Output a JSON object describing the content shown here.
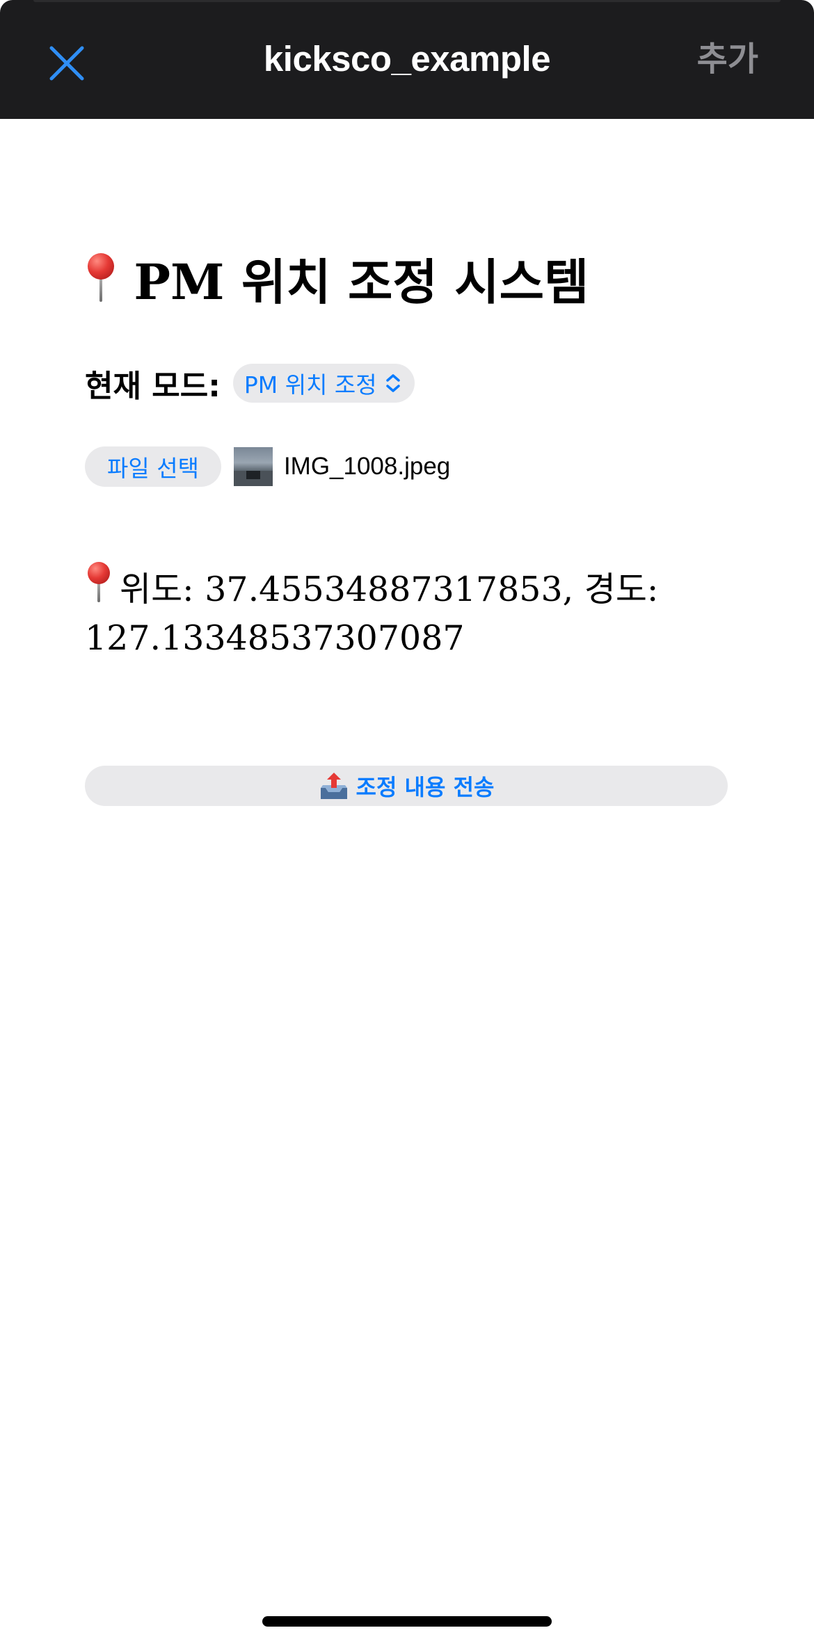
{
  "navbar": {
    "title": "kicksco_example",
    "add_label": "추가",
    "close_icon": "close-icon",
    "close_color": "#2f8ef5"
  },
  "page": {
    "heading": "PM 위치 조정 시스템",
    "heading_icon": "pushpin-icon",
    "mode_label": "현재 모드:",
    "mode_selected": "PM 위치 조정",
    "file_button_label": "파일 선택",
    "file_name": "IMG_1008.jpeg",
    "coords_text": "위도: 37.45534887317853, 경도: 127.13348537307087",
    "coords_icon": "pushpin-icon",
    "submit_label": "조정 내용 전송",
    "submit_icon": "outbox-tray-icon"
  },
  "colors": {
    "accent": "#0a7cff",
    "navbar_bg": "#1c1c1e",
    "button_bg": "#e9e9eb",
    "inactive": "#8e8e93"
  }
}
